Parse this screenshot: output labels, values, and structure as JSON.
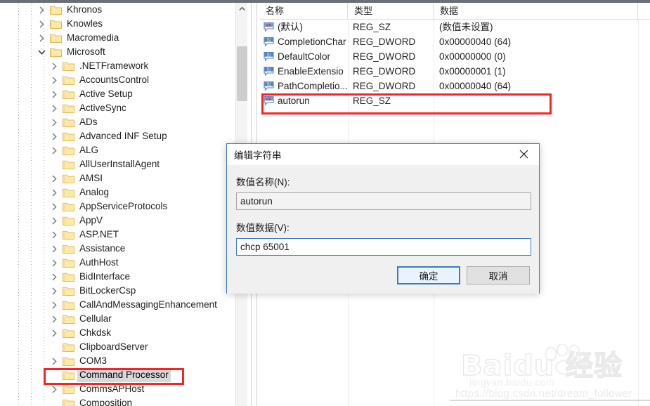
{
  "app": {
    "name": "Registry Editor",
    "accent_color": "#3a7cbe",
    "annotation_color": "#fa2323",
    "folder_color": "#ffe09a",
    "selection_color": "#d9d9d9"
  },
  "tree": {
    "name": "registry-key-tree",
    "scroll_up_icon": "chevron-up-icon",
    "items": [
      {
        "label": "Khronos",
        "depth": 1,
        "expandable": true,
        "expanded": false,
        "selected": false
      },
      {
        "label": "Knowles",
        "depth": 1,
        "expandable": true,
        "expanded": false,
        "selected": false
      },
      {
        "label": "Macromedia",
        "depth": 1,
        "expandable": true,
        "expanded": false,
        "selected": false
      },
      {
        "label": "Microsoft",
        "depth": 1,
        "expandable": true,
        "expanded": true,
        "selected": false
      },
      {
        "label": ".NETFramework",
        "depth": 2,
        "expandable": true,
        "expanded": false,
        "selected": false
      },
      {
        "label": "AccountsControl",
        "depth": 2,
        "expandable": true,
        "expanded": false,
        "selected": false
      },
      {
        "label": "Active Setup",
        "depth": 2,
        "expandable": true,
        "expanded": false,
        "selected": false
      },
      {
        "label": "ActiveSync",
        "depth": 2,
        "expandable": true,
        "expanded": false,
        "selected": false
      },
      {
        "label": "ADs",
        "depth": 2,
        "expandable": true,
        "expanded": false,
        "selected": false
      },
      {
        "label": "Advanced INF Setup",
        "depth": 2,
        "expandable": true,
        "expanded": false,
        "selected": false
      },
      {
        "label": "ALG",
        "depth": 2,
        "expandable": true,
        "expanded": false,
        "selected": false
      },
      {
        "label": "AllUserInstallAgent",
        "depth": 2,
        "expandable": false,
        "expanded": false,
        "selected": false
      },
      {
        "label": "AMSI",
        "depth": 2,
        "expandable": true,
        "expanded": false,
        "selected": false
      },
      {
        "label": "Analog",
        "depth": 2,
        "expandable": true,
        "expanded": false,
        "selected": false
      },
      {
        "label": "AppServiceProtocols",
        "depth": 2,
        "expandable": true,
        "expanded": false,
        "selected": false
      },
      {
        "label": "AppV",
        "depth": 2,
        "expandable": true,
        "expanded": false,
        "selected": false
      },
      {
        "label": "ASP.NET",
        "depth": 2,
        "expandable": true,
        "expanded": false,
        "selected": false
      },
      {
        "label": "Assistance",
        "depth": 2,
        "expandable": true,
        "expanded": false,
        "selected": false
      },
      {
        "label": "AuthHost",
        "depth": 2,
        "expandable": true,
        "expanded": false,
        "selected": false
      },
      {
        "label": "BidInterface",
        "depth": 2,
        "expandable": true,
        "expanded": false,
        "selected": false
      },
      {
        "label": "BitLockerCsp",
        "depth": 2,
        "expandable": true,
        "expanded": false,
        "selected": false
      },
      {
        "label": "CallAndMessagingEnhancement",
        "depth": 2,
        "expandable": true,
        "expanded": false,
        "selected": false
      },
      {
        "label": "Cellular",
        "depth": 2,
        "expandable": true,
        "expanded": false,
        "selected": false
      },
      {
        "label": "Chkdsk",
        "depth": 2,
        "expandable": true,
        "expanded": false,
        "selected": false
      },
      {
        "label": "ClipboardServer",
        "depth": 2,
        "expandable": false,
        "expanded": false,
        "selected": false
      },
      {
        "label": "COM3",
        "depth": 2,
        "expandable": true,
        "expanded": false,
        "selected": false
      },
      {
        "label": "Command Processor",
        "depth": 2,
        "expandable": false,
        "expanded": false,
        "selected": true
      },
      {
        "label": "CommsAPHost",
        "depth": 2,
        "expandable": true,
        "expanded": false,
        "selected": false
      },
      {
        "label": "Composition",
        "depth": 2,
        "expandable": false,
        "expanded": false,
        "selected": false
      }
    ]
  },
  "values": {
    "name": "registry-values-list",
    "columns": [
      "名称",
      "类型",
      "数据"
    ],
    "rows": [
      {
        "icon": "string-value-icon",
        "name": "(默认)",
        "type": "REG_SZ",
        "data": "(数值未设置)"
      },
      {
        "icon": "dword-value-icon",
        "name": "CompletionChar",
        "type": "REG_DWORD",
        "data": "0x00000040 (64)"
      },
      {
        "icon": "dword-value-icon",
        "name": "DefaultColor",
        "type": "REG_DWORD",
        "data": "0x00000000 (0)"
      },
      {
        "icon": "dword-value-icon",
        "name": "EnableExtensio",
        "type": "REG_DWORD",
        "data": "0x00000001 (1)"
      },
      {
        "icon": "dword-value-icon",
        "name": "PathCompletio...",
        "type": "REG_DWORD",
        "data": "0x00000040 (64)"
      },
      {
        "icon": "string-value-icon",
        "name": "autorun",
        "type": "REG_SZ",
        "data": ""
      }
    ]
  },
  "dialog": {
    "name": "edit-string-dialog",
    "title": "编辑字符串",
    "close_icon": "close-icon",
    "name_label": "数值名称(N):",
    "name_value": "autorun",
    "name_placeholder": "",
    "data_label": "数值数据(V):",
    "data_value": "chcp 65001",
    "data_placeholder": "",
    "ok_label": "确定",
    "cancel_label": "取消"
  },
  "annotations": {
    "autorun_row_box": "highlight-autorun-row",
    "command_processor_box": "highlight-command-processor-key"
  },
  "watermark": {
    "brand": "Baidu 经验",
    "site": "jingyan.baidu.com",
    "url": "https://blog.csdn.net/dream_follower"
  }
}
